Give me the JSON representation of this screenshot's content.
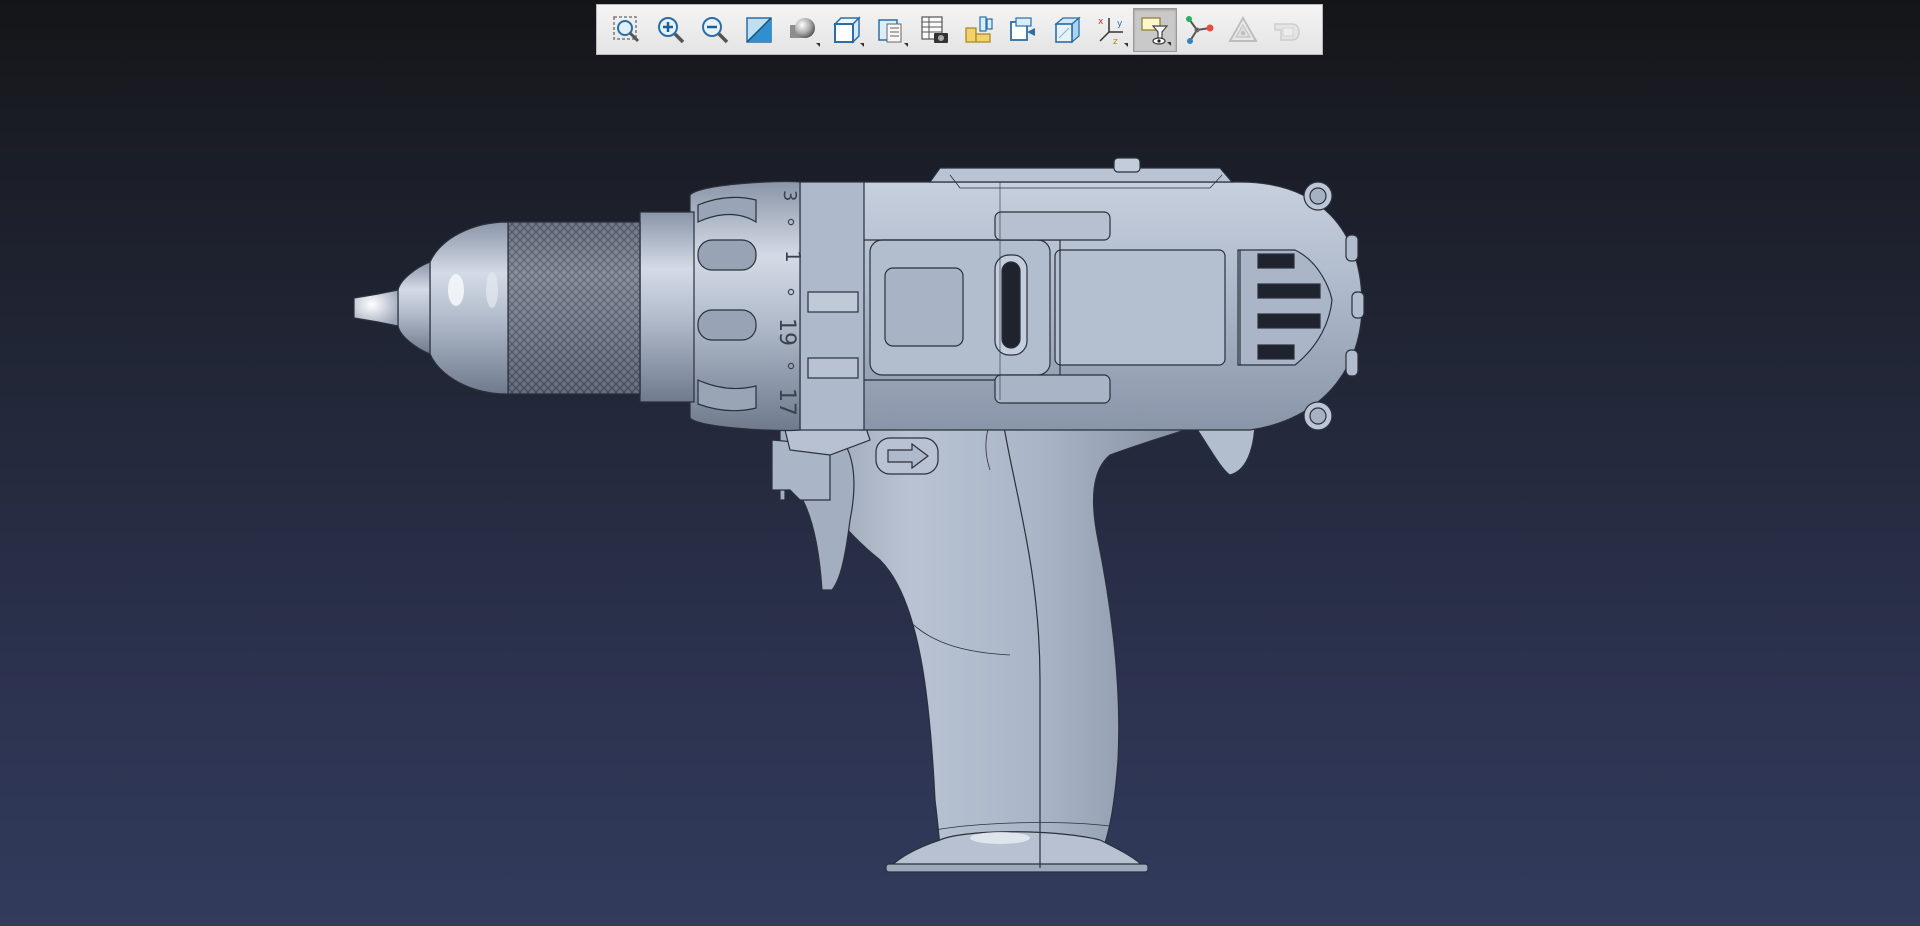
{
  "toolbar": {
    "buttons": [
      {
        "name": "zoom-fit-button",
        "icon": "zoom-fit-icon"
      },
      {
        "name": "zoom-in-button",
        "icon": "zoom-in-icon"
      },
      {
        "name": "zoom-out-button",
        "icon": "zoom-out-icon"
      },
      {
        "name": "zoom-area-button",
        "icon": "zoom-area-icon"
      },
      {
        "name": "display-style-button",
        "icon": "shaded-sphere-icon",
        "dropdown": true
      },
      {
        "name": "view-orientation-button",
        "icon": "cube-view-icon",
        "dropdown": true
      },
      {
        "name": "section-view-button",
        "icon": "section-view-icon",
        "dropdown": true
      },
      {
        "name": "snapshot-button",
        "icon": "camera-table-icon"
      },
      {
        "name": "measure-button",
        "icon": "measure-icon"
      },
      {
        "name": "explode-button",
        "icon": "explode-icon"
      },
      {
        "name": "transparency-button",
        "icon": "transparent-box-icon"
      },
      {
        "name": "axes-button",
        "icon": "axes-icon",
        "dropdown": true
      },
      {
        "name": "visibility-button",
        "icon": "visibility-eye-icon",
        "dropdown": true,
        "active": true
      },
      {
        "name": "hierarchy-button",
        "icon": "node-tree-icon"
      },
      {
        "name": "markup-button",
        "icon": "recycle-triangle-icon",
        "disabled": true
      },
      {
        "name": "extra-button",
        "icon": "grey-shape-icon",
        "disabled": true
      }
    ]
  },
  "model": {
    "description_name": "cordless-drill-model",
    "dial_numbers": [
      "3",
      "1",
      "19",
      "17"
    ],
    "colors": {
      "body": "#a9b4c6",
      "body_dark": "#7d889b",
      "body_light": "#c9d2e0",
      "edge": "#2a303c"
    }
  }
}
